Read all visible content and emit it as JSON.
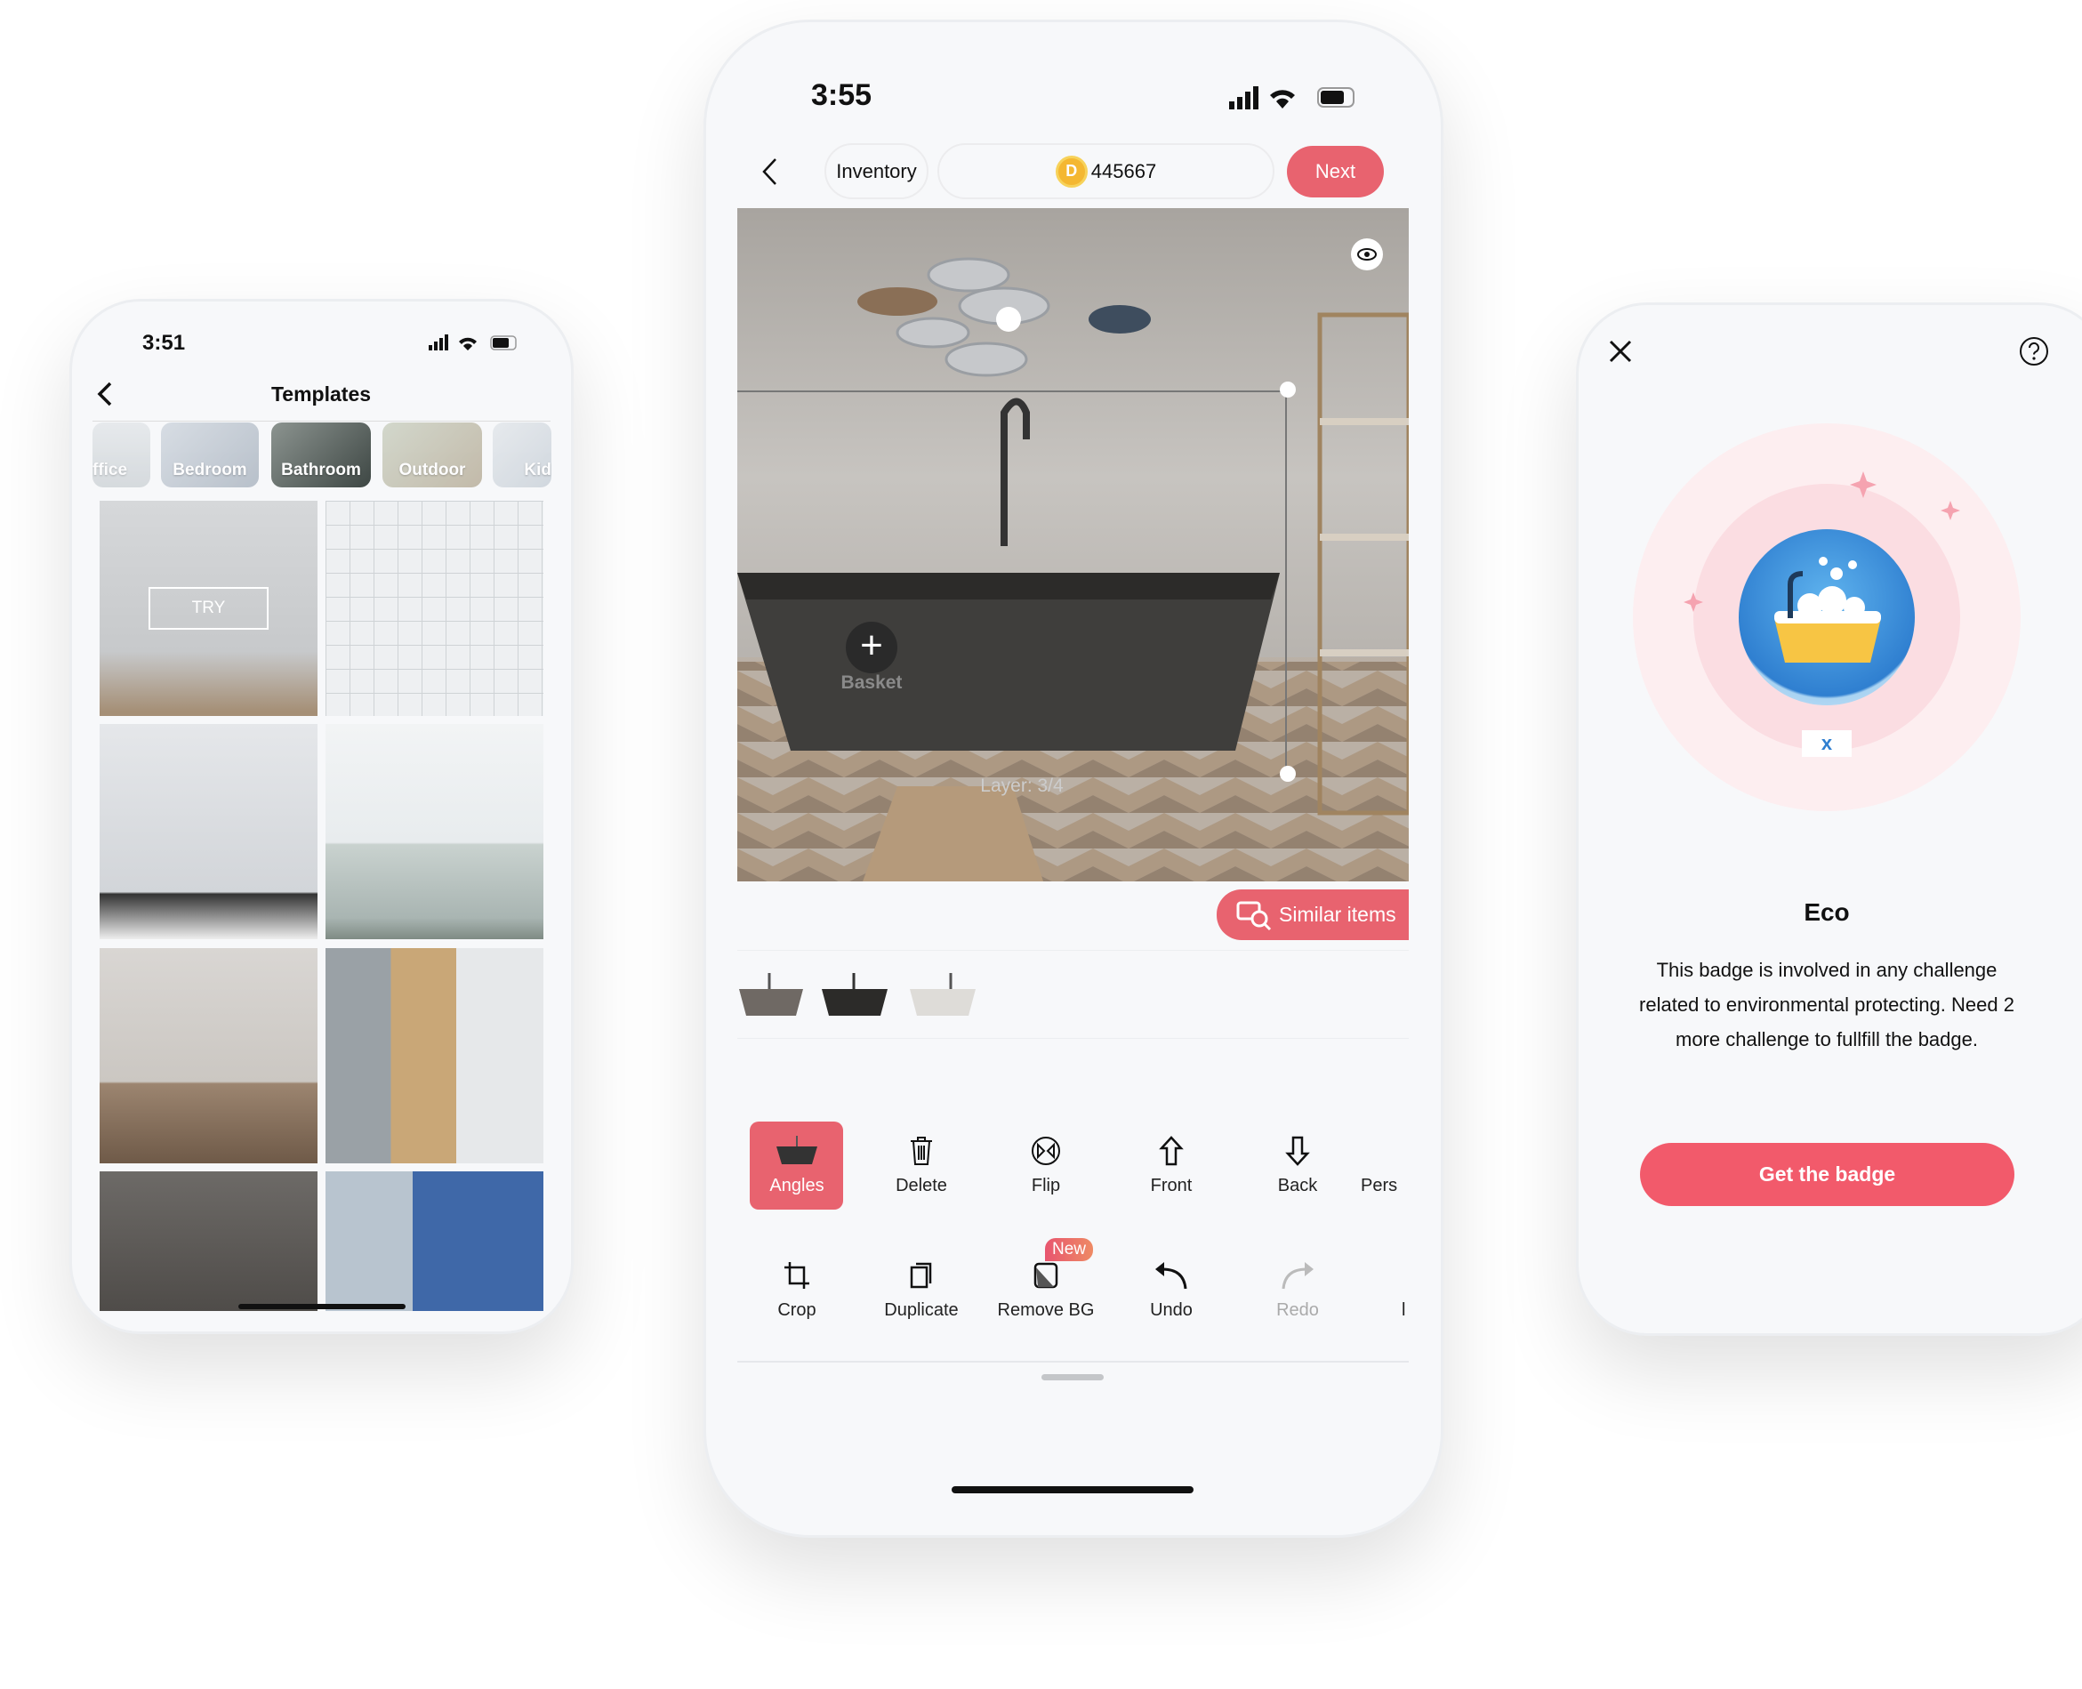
{
  "left_phone": {
    "status_time": "3:51",
    "title": "Templates",
    "categories": [
      {
        "label": "ffice"
      },
      {
        "label": "Bedroom"
      },
      {
        "label": "Bathroom"
      },
      {
        "label": "Outdoor"
      },
      {
        "label": "Kid"
      }
    ],
    "try_label": "TRY"
  },
  "center_phone": {
    "status_time": "3:55",
    "inventory_label": "Inventory",
    "coin_balance": "445667",
    "next_label": "Next",
    "canvas": {
      "item_label": "Basket",
      "layer_label": "Layer: 3/4"
    },
    "similar_items_label": "Similar items",
    "tools_row1": [
      {
        "label": "Angles",
        "icon": "bathtub-icon",
        "active": true
      },
      {
        "label": "Delete",
        "icon": "trash-icon"
      },
      {
        "label": "Flip",
        "icon": "flip-icon"
      },
      {
        "label": "Front",
        "icon": "arrow-up-icon"
      },
      {
        "label": "Back",
        "icon": "arrow-down-icon"
      },
      {
        "label": "Pers",
        "icon": ""
      }
    ],
    "tools_row2": [
      {
        "label": "Crop",
        "icon": "crop-icon"
      },
      {
        "label": "Duplicate",
        "icon": "duplicate-icon"
      },
      {
        "label": "Remove BG",
        "icon": "remove-bg-icon",
        "badge": "New"
      },
      {
        "label": "Undo",
        "icon": "undo-icon"
      },
      {
        "label": "Redo",
        "icon": "redo-icon",
        "disabled": true
      },
      {
        "label": "l",
        "icon": ""
      }
    ]
  },
  "right_phone": {
    "badge_label": "x",
    "title": "Eco",
    "description": "This badge is involved in any challenge related to environmental protecting. Need 2 more challenge to fullfill the badge.",
    "cta_label": "Get the badge"
  },
  "colors": {
    "accent": "#e8636f",
    "cta": "#f25a6b",
    "coin": "#f4b731",
    "badge_blue": "#2f7fd0"
  }
}
